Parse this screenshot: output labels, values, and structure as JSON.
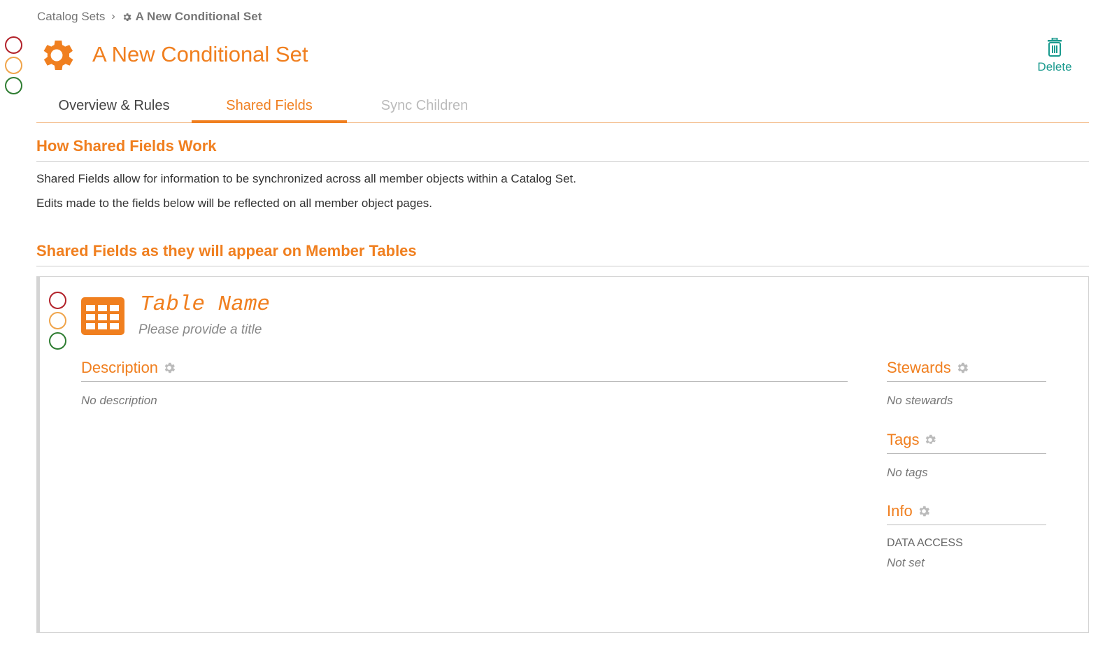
{
  "breadcrumb": {
    "parent": "Catalog Sets",
    "current": "A New Conditional Set"
  },
  "header": {
    "title": "A New Conditional Set",
    "delete_label": "Delete"
  },
  "tabs": [
    {
      "label": "Overview & Rules",
      "state": "default"
    },
    {
      "label": "Shared Fields",
      "state": "active"
    },
    {
      "label": "Sync Children",
      "state": "disabled"
    }
  ],
  "how_section": {
    "heading": "How Shared Fields Work",
    "line1": "Shared Fields allow for information to be synchronized across all member objects within a Catalog Set.",
    "line2": "Edits made to the fields below will be reflected on all member object pages."
  },
  "preview_section": {
    "heading": "Shared Fields as they will appear on Member Tables",
    "table_name": "Table Name",
    "table_subtitle": "Please provide a title",
    "description": {
      "label": "Description",
      "value": "No description"
    },
    "stewards": {
      "label": "Stewards",
      "value": "No stewards"
    },
    "tags": {
      "label": "Tags",
      "value": "No tags"
    },
    "info": {
      "label": "Info",
      "field_label": "DATA ACCESS",
      "value": "Not set"
    }
  },
  "colors": {
    "accent": "#f07f1f",
    "delete": "#1a9a8e",
    "status_red": "#b2222a",
    "status_yellow": "#f0a44a",
    "status_green": "#2f7d32"
  },
  "icons": [
    "gear-icon",
    "chevron-right-icon",
    "trash-icon",
    "table-icon"
  ]
}
